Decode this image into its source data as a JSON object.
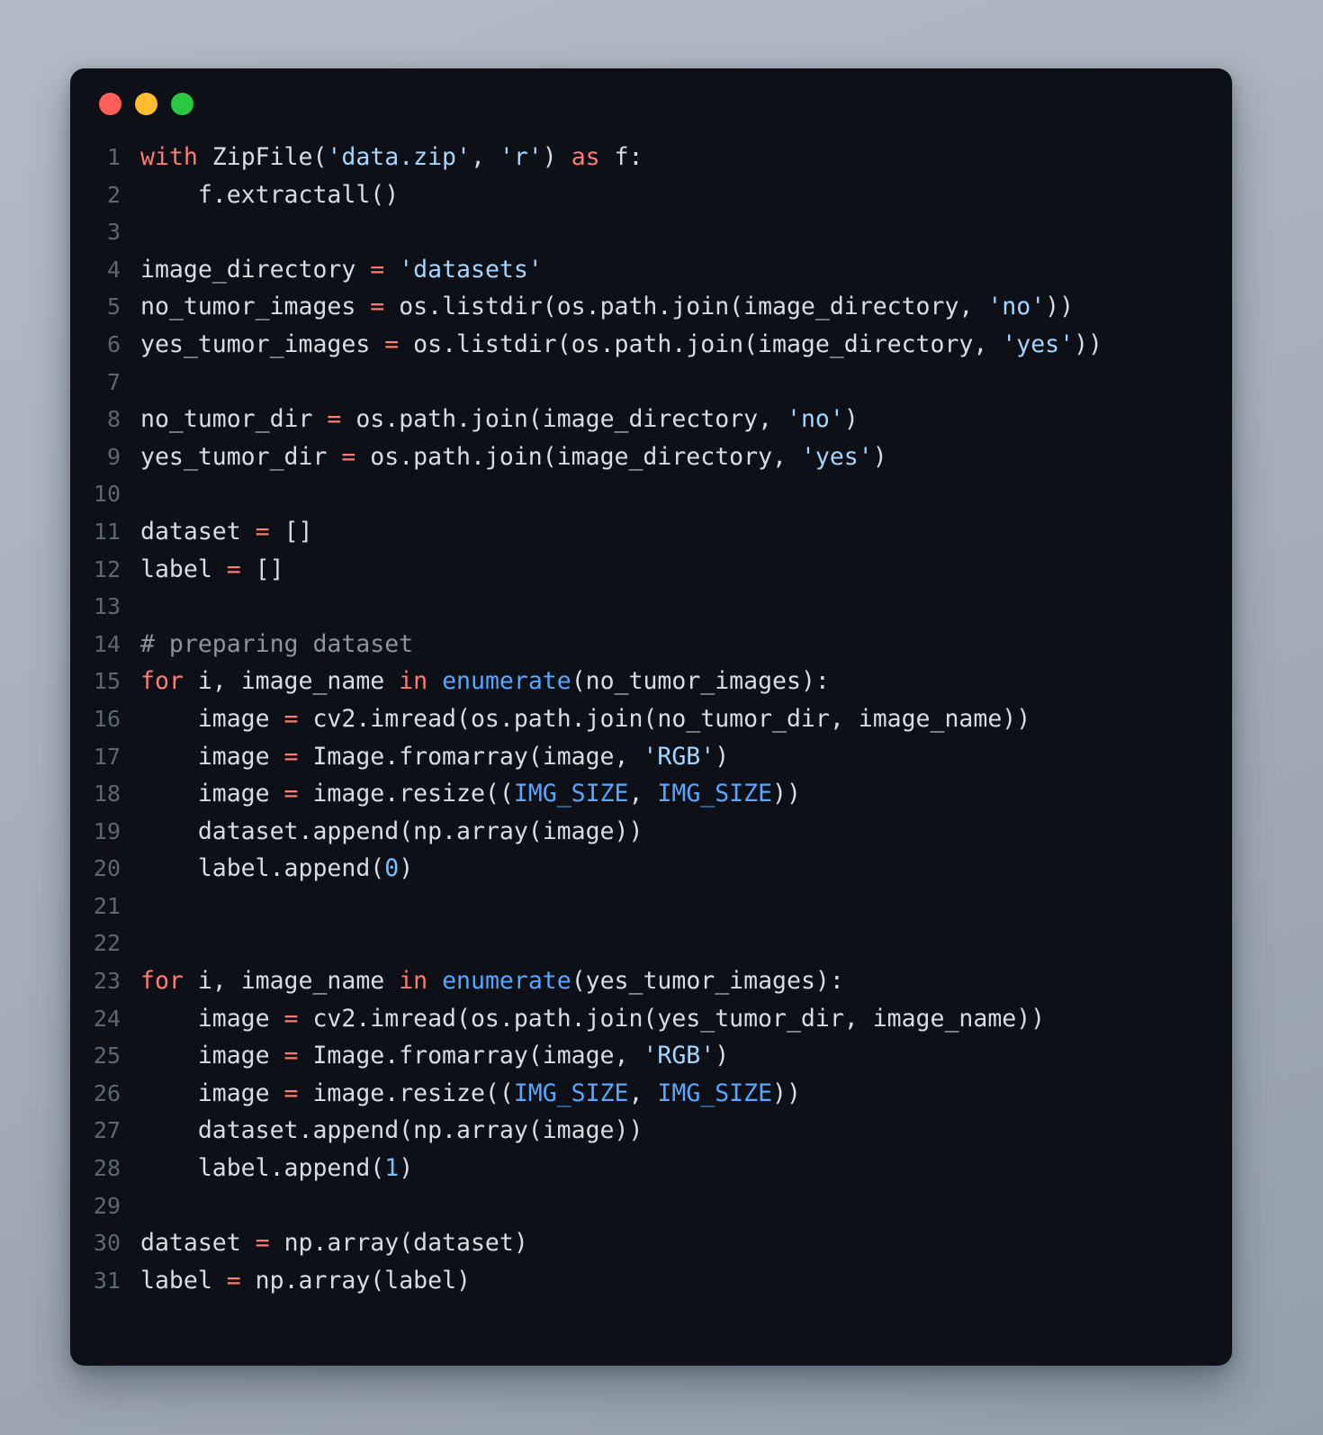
{
  "window": {
    "title": "",
    "theme_background": "#0d1117",
    "page_background": "#a6b0bb",
    "traffic_lights": [
      {
        "name": "close",
        "label": "Close",
        "color": "#ff5f57"
      },
      {
        "name": "minimize",
        "label": "Minimize",
        "color": "#febc2e"
      },
      {
        "name": "maximize",
        "label": "Maximize",
        "color": "#28c840"
      }
    ]
  },
  "editor": {
    "language": "python",
    "first_line_number": 1,
    "last_line_number": 31,
    "total_lines": 31,
    "colors": {
      "background": "#0d1117",
      "foreground": "#d7dde5",
      "line_number": "#5c6773",
      "keyword": "#ff7b72",
      "operator": "#ff7b72",
      "string": "#a5d6ff",
      "number": "#79c0ff",
      "function": "#58a6ff",
      "constant": "#58a6ff",
      "comment": "#8b949e"
    },
    "line_numbers": [
      "1",
      "2",
      "3",
      "4",
      "5",
      "6",
      "7",
      "8",
      "9",
      "10",
      "11",
      "12",
      "13",
      "14",
      "15",
      "16",
      "17",
      "18",
      "19",
      "20",
      "21",
      "22",
      "23",
      "24",
      "25",
      "26",
      "27",
      "28",
      "29",
      "30",
      "31"
    ],
    "lines": [
      {
        "n": "1",
        "text": "with ZipFile('data.zip', 'r') as f:"
      },
      {
        "n": "2",
        "text": "    f.extractall()"
      },
      {
        "n": "3",
        "text": ""
      },
      {
        "n": "4",
        "text": "image_directory = 'datasets'"
      },
      {
        "n": "5",
        "text": "no_tumor_images = os.listdir(os.path.join(image_directory, 'no'))"
      },
      {
        "n": "6",
        "text": "yes_tumor_images = os.listdir(os.path.join(image_directory, 'yes'))"
      },
      {
        "n": "7",
        "text": ""
      },
      {
        "n": "8",
        "text": "no_tumor_dir = os.path.join(image_directory, 'no')"
      },
      {
        "n": "9",
        "text": "yes_tumor_dir = os.path.join(image_directory, 'yes')"
      },
      {
        "n": "10",
        "text": ""
      },
      {
        "n": "11",
        "text": "dataset = []"
      },
      {
        "n": "12",
        "text": "label = []"
      },
      {
        "n": "13",
        "text": ""
      },
      {
        "n": "14",
        "text": "# preparing dataset"
      },
      {
        "n": "15",
        "text": "for i, image_name in enumerate(no_tumor_images):"
      },
      {
        "n": "16",
        "text": "    image = cv2.imread(os.path.join(no_tumor_dir, image_name))"
      },
      {
        "n": "17",
        "text": "    image = Image.fromarray(image, 'RGB')"
      },
      {
        "n": "18",
        "text": "    image = image.resize((IMG_SIZE, IMG_SIZE))"
      },
      {
        "n": "19",
        "text": "    dataset.append(np.array(image))"
      },
      {
        "n": "20",
        "text": "    label.append(0)"
      },
      {
        "n": "21",
        "text": ""
      },
      {
        "n": "22",
        "text": ""
      },
      {
        "n": "23",
        "text": "for i, image_name in enumerate(yes_tumor_images):"
      },
      {
        "n": "24",
        "text": "    image = cv2.imread(os.path.join(yes_tumor_dir, image_name))"
      },
      {
        "n": "25",
        "text": "    image = Image.fromarray(image, 'RGB')"
      },
      {
        "n": "26",
        "text": "    image = image.resize((IMG_SIZE, IMG_SIZE))"
      },
      {
        "n": "27",
        "text": "    dataset.append(np.array(image))"
      },
      {
        "n": "28",
        "text": "    label.append(1)"
      },
      {
        "n": "29",
        "text": ""
      },
      {
        "n": "30",
        "text": "dataset = np.array(dataset)"
      },
      {
        "n": "31",
        "text": "label = np.array(label)"
      }
    ],
    "tokens": [
      {
        "n": "1",
        "parts": [
          {
            "c": "kw",
            "t": "with"
          },
          {
            "c": "id",
            "t": " ZipFile("
          },
          {
            "c": "str",
            "t": "'data.zip'"
          },
          {
            "c": "id",
            "t": ", "
          },
          {
            "c": "str",
            "t": "'r'"
          },
          {
            "c": "id",
            "t": ") "
          },
          {
            "c": "kw",
            "t": "as"
          },
          {
            "c": "id",
            "t": " f:"
          }
        ]
      },
      {
        "n": "2",
        "parts": [
          {
            "c": "id",
            "t": "    f.extractall()"
          }
        ]
      },
      {
        "n": "3",
        "parts": [
          {
            "c": "id",
            "t": ""
          }
        ]
      },
      {
        "n": "4",
        "parts": [
          {
            "c": "id",
            "t": "image_directory "
          },
          {
            "c": "op",
            "t": "="
          },
          {
            "c": "id",
            "t": " "
          },
          {
            "c": "str",
            "t": "'datasets'"
          }
        ]
      },
      {
        "n": "5",
        "parts": [
          {
            "c": "id",
            "t": "no_tumor_images "
          },
          {
            "c": "op",
            "t": "="
          },
          {
            "c": "id",
            "t": " os.listdir(os.path.join(image_directory, "
          },
          {
            "c": "str",
            "t": "'no'"
          },
          {
            "c": "id",
            "t": "))"
          }
        ]
      },
      {
        "n": "6",
        "parts": [
          {
            "c": "id",
            "t": "yes_tumor_images "
          },
          {
            "c": "op",
            "t": "="
          },
          {
            "c": "id",
            "t": " os.listdir(os.path.join(image_directory, "
          },
          {
            "c": "str",
            "t": "'yes'"
          },
          {
            "c": "id",
            "t": "))"
          }
        ]
      },
      {
        "n": "7",
        "parts": [
          {
            "c": "id",
            "t": ""
          }
        ]
      },
      {
        "n": "8",
        "parts": [
          {
            "c": "id",
            "t": "no_tumor_dir "
          },
          {
            "c": "op",
            "t": "="
          },
          {
            "c": "id",
            "t": " os.path.join(image_directory, "
          },
          {
            "c": "str",
            "t": "'no'"
          },
          {
            "c": "id",
            "t": ")"
          }
        ]
      },
      {
        "n": "9",
        "parts": [
          {
            "c": "id",
            "t": "yes_tumor_dir "
          },
          {
            "c": "op",
            "t": "="
          },
          {
            "c": "id",
            "t": " os.path.join(image_directory, "
          },
          {
            "c": "str",
            "t": "'yes'"
          },
          {
            "c": "id",
            "t": ")"
          }
        ]
      },
      {
        "n": "10",
        "parts": [
          {
            "c": "id",
            "t": ""
          }
        ]
      },
      {
        "n": "11",
        "parts": [
          {
            "c": "id",
            "t": "dataset "
          },
          {
            "c": "op",
            "t": "="
          },
          {
            "c": "id",
            "t": " []"
          }
        ]
      },
      {
        "n": "12",
        "parts": [
          {
            "c": "id",
            "t": "label "
          },
          {
            "c": "op",
            "t": "="
          },
          {
            "c": "id",
            "t": " []"
          }
        ]
      },
      {
        "n": "13",
        "parts": [
          {
            "c": "id",
            "t": ""
          }
        ]
      },
      {
        "n": "14",
        "parts": [
          {
            "c": "cmt",
            "t": "# preparing dataset"
          }
        ]
      },
      {
        "n": "15",
        "parts": [
          {
            "c": "kw",
            "t": "for"
          },
          {
            "c": "id",
            "t": " i, image_name "
          },
          {
            "c": "kw",
            "t": "in"
          },
          {
            "c": "id",
            "t": " "
          },
          {
            "c": "fn",
            "t": "enumerate"
          },
          {
            "c": "id",
            "t": "(no_tumor_images):"
          }
        ]
      },
      {
        "n": "16",
        "parts": [
          {
            "c": "id",
            "t": "    image "
          },
          {
            "c": "op",
            "t": "="
          },
          {
            "c": "id",
            "t": " cv2.imread(os.path.join(no_tumor_dir, image_name))"
          }
        ]
      },
      {
        "n": "17",
        "parts": [
          {
            "c": "id",
            "t": "    image "
          },
          {
            "c": "op",
            "t": "="
          },
          {
            "c": "id",
            "t": " Image.fromarray(image, "
          },
          {
            "c": "str",
            "t": "'RGB'"
          },
          {
            "c": "id",
            "t": ")"
          }
        ]
      },
      {
        "n": "18",
        "parts": [
          {
            "c": "id",
            "t": "    image "
          },
          {
            "c": "op",
            "t": "="
          },
          {
            "c": "id",
            "t": " image.resize(("
          },
          {
            "c": "const",
            "t": "IMG_SIZE"
          },
          {
            "c": "id",
            "t": ", "
          },
          {
            "c": "const",
            "t": "IMG_SIZE"
          },
          {
            "c": "id",
            "t": "))"
          }
        ]
      },
      {
        "n": "19",
        "parts": [
          {
            "c": "id",
            "t": "    dataset.append(np.array(image))"
          }
        ]
      },
      {
        "n": "20",
        "parts": [
          {
            "c": "id",
            "t": "    label.append("
          },
          {
            "c": "num",
            "t": "0"
          },
          {
            "c": "id",
            "t": ")"
          }
        ]
      },
      {
        "n": "21",
        "parts": [
          {
            "c": "id",
            "t": ""
          }
        ]
      },
      {
        "n": "22",
        "parts": [
          {
            "c": "id",
            "t": ""
          }
        ]
      },
      {
        "n": "23",
        "parts": [
          {
            "c": "kw",
            "t": "for"
          },
          {
            "c": "id",
            "t": " i, image_name "
          },
          {
            "c": "kw",
            "t": "in"
          },
          {
            "c": "id",
            "t": " "
          },
          {
            "c": "fn",
            "t": "enumerate"
          },
          {
            "c": "id",
            "t": "(yes_tumor_images):"
          }
        ]
      },
      {
        "n": "24",
        "parts": [
          {
            "c": "id",
            "t": "    image "
          },
          {
            "c": "op",
            "t": "="
          },
          {
            "c": "id",
            "t": " cv2.imread(os.path.join(yes_tumor_dir, image_name))"
          }
        ]
      },
      {
        "n": "25",
        "parts": [
          {
            "c": "id",
            "t": "    image "
          },
          {
            "c": "op",
            "t": "="
          },
          {
            "c": "id",
            "t": " Image.fromarray(image, "
          },
          {
            "c": "str",
            "t": "'RGB'"
          },
          {
            "c": "id",
            "t": ")"
          }
        ]
      },
      {
        "n": "26",
        "parts": [
          {
            "c": "id",
            "t": "    image "
          },
          {
            "c": "op",
            "t": "="
          },
          {
            "c": "id",
            "t": " image.resize(("
          },
          {
            "c": "const",
            "t": "IMG_SIZE"
          },
          {
            "c": "id",
            "t": ", "
          },
          {
            "c": "const",
            "t": "IMG_SIZE"
          },
          {
            "c": "id",
            "t": "))"
          }
        ]
      },
      {
        "n": "27",
        "parts": [
          {
            "c": "id",
            "t": "    dataset.append(np.array(image))"
          }
        ]
      },
      {
        "n": "28",
        "parts": [
          {
            "c": "id",
            "t": "    label.append("
          },
          {
            "c": "num",
            "t": "1"
          },
          {
            "c": "id",
            "t": ")"
          }
        ]
      },
      {
        "n": "29",
        "parts": [
          {
            "c": "id",
            "t": ""
          }
        ]
      },
      {
        "n": "30",
        "parts": [
          {
            "c": "id",
            "t": "dataset "
          },
          {
            "c": "op",
            "t": "="
          },
          {
            "c": "id",
            "t": " np.array(dataset)"
          }
        ]
      },
      {
        "n": "31",
        "parts": [
          {
            "c": "id",
            "t": "label "
          },
          {
            "c": "op",
            "t": "="
          },
          {
            "c": "id",
            "t": " np.array(label)"
          }
        ]
      }
    ]
  }
}
